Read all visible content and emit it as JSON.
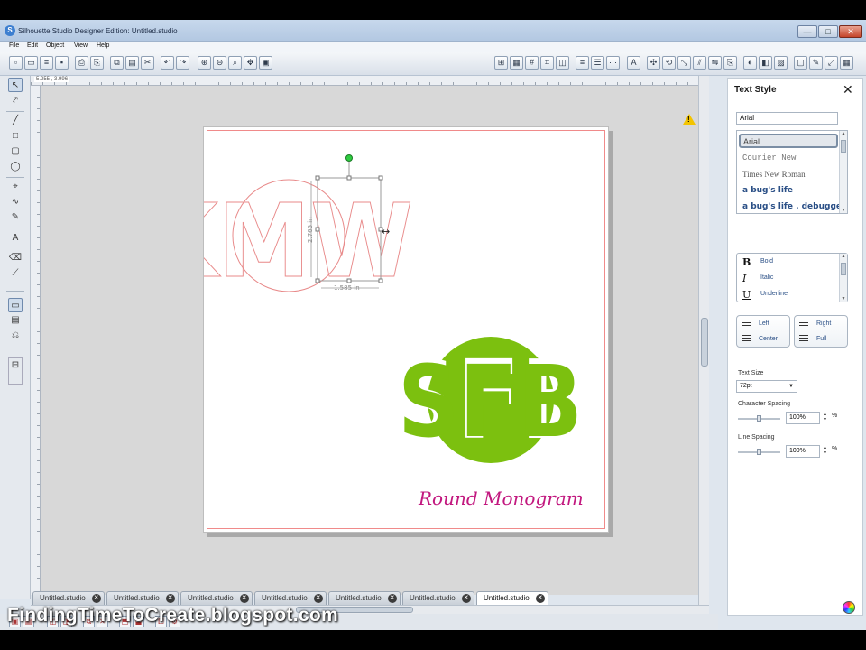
{
  "window": {
    "title": "Silhouette Studio Designer Edition: Untitled.studio",
    "minimize": "—",
    "maximize": "□",
    "close": "✕"
  },
  "menu": [
    "File",
    "Edit",
    "Object",
    "View",
    "Help"
  ],
  "ruler": {
    "coords": "5.255 , 3.996"
  },
  "canvas": {
    "selection": {
      "text": "KMW",
      "height_label": "2.765 in",
      "width_label": "1.585 in",
      "stroke_color": "#e88a8a"
    },
    "monogram": {
      "text": "SFB",
      "color": "#7cc00f"
    },
    "caption": {
      "text": "Round Monogram",
      "color": "#c2187f"
    },
    "warning_icon": "warning-icon"
  },
  "tabs": [
    {
      "label": "Untitled.studio",
      "active": false
    },
    {
      "label": "Untitled.studio",
      "active": false
    },
    {
      "label": "Untitled.studio",
      "active": false
    },
    {
      "label": "Untitled.studio",
      "active": false
    },
    {
      "label": "Untitled.studio",
      "active": false
    },
    {
      "label": "Untitled.studio",
      "active": false
    },
    {
      "label": "Untitled.studio",
      "active": true
    }
  ],
  "watermark": "FindingTimeToCreate.blogspot.com",
  "panel": {
    "title": "Text Style",
    "font_input": "Arial",
    "fonts": [
      {
        "label": "Arial",
        "family": "Liberation Sans"
      },
      {
        "label": "Courier New",
        "family": "Liberation Mono"
      },
      {
        "label": "Times New Roman",
        "family": "Liberation Serif"
      },
      {
        "label": "a bug's life",
        "family": "DejaVu Sans"
      },
      {
        "label": "a bug's life . debugged",
        "family": "DejaVu Sans"
      }
    ],
    "styles": [
      {
        "glyph": "B",
        "label": "Bold"
      },
      {
        "glyph": "I",
        "label": "Italic"
      },
      {
        "glyph": "U",
        "label": "Underline"
      }
    ],
    "align": {
      "left": "Left",
      "center": "Center",
      "right": "Right",
      "full": "Full"
    },
    "text_size": {
      "label": "Text Size",
      "value": "72pt"
    },
    "char_spacing": {
      "label": "Character Spacing",
      "value": "100%",
      "unit": "%"
    },
    "line_spacing": {
      "label": "Line Spacing",
      "value": "100%",
      "unit": "%"
    }
  }
}
